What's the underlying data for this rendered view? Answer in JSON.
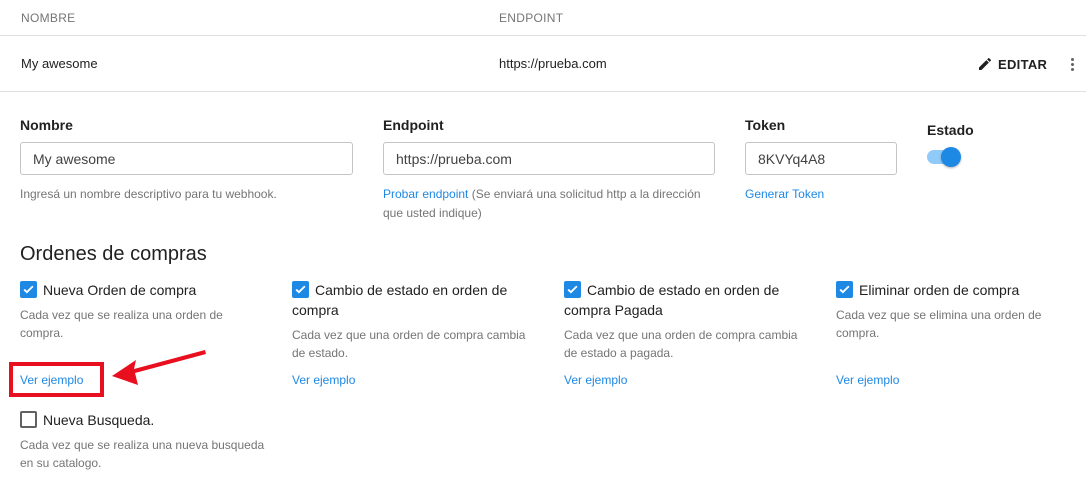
{
  "table": {
    "columns": {
      "name": "NOMBRE",
      "endpoint": "ENDPOINT"
    },
    "row": {
      "name": "My awesome",
      "endpoint": "https://prueba.com",
      "edit_label": "EDITAR"
    }
  },
  "form": {
    "nombre": {
      "label": "Nombre",
      "value": "My awesome",
      "helper": "Ingresá un nombre descriptivo para tu webhook."
    },
    "endpoint": {
      "label": "Endpoint",
      "value": "https://prueba.com",
      "helper_link": "Probar endpoint",
      "helper_line1": " (Se enviará una solicitud http a la dirección",
      "helper_line2": "que usted indique)"
    },
    "token": {
      "label": "Token",
      "value": "8KVYq4A8",
      "link": "Generar Token"
    },
    "estado": {
      "label": "Estado",
      "enabled": true
    }
  },
  "section_title": "Ordenes de compras",
  "events": [
    {
      "label": "Nueva Orden de compra",
      "checked": true,
      "desc_line1": "Cada vez que se realiza una orden de",
      "desc_line2": "compra.",
      "link": "Ver ejemplo"
    },
    {
      "label_line1": "Cambio de estado en orden de",
      "label_line2": "compra",
      "checked": true,
      "desc_line1": "Cada vez que una orden de compra cambia",
      "desc_line2": "de estado.",
      "link": "Ver ejemplo"
    },
    {
      "label_line1": "Cambio de estado en orden de",
      "label_line2": "compra Pagada",
      "checked": true,
      "desc_line1": "Cada vez que una orden de compra cambia",
      "desc_line2": "de estado a pagada.",
      "link": "Ver ejemplo"
    },
    {
      "label": "Eliminar orden de compra",
      "checked": true,
      "desc_line1": "Cada vez que se elimina una orden de",
      "desc_line2": "compra.",
      "link": "Ver ejemplo"
    },
    {
      "label": "Nueva Busqueda.",
      "checked": false,
      "desc_line1": "Cada vez que se realiza una nueva busqueda",
      "desc_line2": "en su catalogo."
    }
  ],
  "colors": {
    "accent": "#1e88e5",
    "annotation": "#e8101f"
  }
}
